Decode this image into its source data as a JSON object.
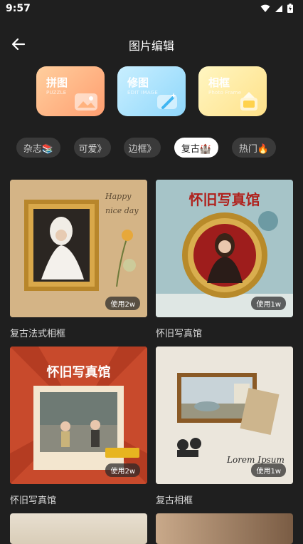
{
  "status": {
    "time": "9:57"
  },
  "header": {
    "title": "图片编辑"
  },
  "cards": [
    {
      "title": "拼图",
      "subtitle": "PUZZLE"
    },
    {
      "title": "修图",
      "subtitle": "EDIT IMAGE"
    },
    {
      "title": "相框",
      "subtitle": "Photo Frame"
    }
  ],
  "chips": [
    {
      "label": "杂志📚"
    },
    {
      "label": "可爱》"
    },
    {
      "label": "边框》"
    },
    {
      "label": "复古🏰",
      "active": true
    },
    {
      "label": "热门🔥"
    }
  ],
  "templates": [
    {
      "caption": "复古法式相框",
      "badge": "使用2w",
      "inner_text": "Happy nice day"
    },
    {
      "caption": "怀旧写真馆",
      "badge": "使用1w",
      "inner_text": "怀旧写真馆"
    },
    {
      "caption": "怀旧写真馆",
      "badge": "使用2w",
      "inner_text": "怀旧写真馆"
    },
    {
      "caption": "复古相框",
      "badge": "使用1w",
      "inner_text": "Lorem Ipsum"
    }
  ],
  "colors": {
    "background": "#1f1f1f",
    "chip_bg": "#3a3a3a",
    "chip_active": "#ffffff"
  }
}
